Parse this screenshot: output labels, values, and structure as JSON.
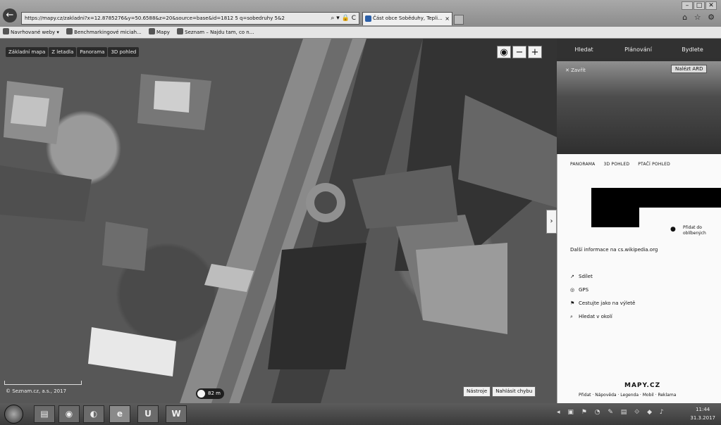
{
  "browser": {
    "url": "https://mapy.cz/zakladni?x=12.8785276&y=50.6588&z=20&source=base&id=1812 5 q=sobedruhy 5&2",
    "tab_title": "Část obce Soběduhy, Tepli...",
    "tab_close": "×",
    "window_controls": [
      "–",
      "□",
      "✕"
    ],
    "toolbar_icons": "⌂ ☆ ⚙",
    "address_icons": "⌕ ▾ 🔒 C",
    "favorites": [
      "Navrhované weby ▾",
      "Benchmarkingové miciah...",
      "Mapy",
      "Seznam – Najdu tam, co n..."
    ]
  },
  "map": {
    "layers": [
      "Základní mapa",
      "Z letadla",
      "Panorama",
      "3D pohled"
    ],
    "zoom_in": "+",
    "zoom_out": "−",
    "scale_label": "82 m",
    "attribution": "© Seznam.cz, a.s., 2017",
    "tools": [
      "Nástroje",
      "Nahlásit chybu"
    ]
  },
  "panorama": {
    "tabs": [
      "Hledat",
      "Plánování",
      "Bydlete"
    ],
    "close_label": "✕ Zavřít",
    "enter_label": "Nalézt ARD"
  },
  "panel": {
    "toggle_icon": "›",
    "view_tabs": [
      "PANORAMA",
      "3D POHLED",
      "PTAČÍ POHLED"
    ],
    "photo_link": "Přidat do oblíbených",
    "wiki_line": "Další informace na cs.wikipedia.org",
    "actions": [
      {
        "icon": "↗",
        "label": "Sdílet"
      },
      {
        "icon": "◎",
        "label": "GPS"
      },
      {
        "icon": "⚑",
        "label": "Cestujte jako na výletě"
      },
      {
        "icon": "⌕",
        "label": "Hledat v okolí"
      }
    ],
    "logo": "MAPY.CZ",
    "footer_links": "Přidat · Nápověda · Legenda · Mobil · Reklama"
  },
  "taskbar": {
    "items": [
      "▤",
      "◉",
      "◐",
      "e",
      "U",
      "W"
    ],
    "tray": "◂ ▣ ⚑ ◔ ✎ ▤ ⟐ ◆ ♪",
    "time": "11:44",
    "date": "31.3.2017"
  }
}
